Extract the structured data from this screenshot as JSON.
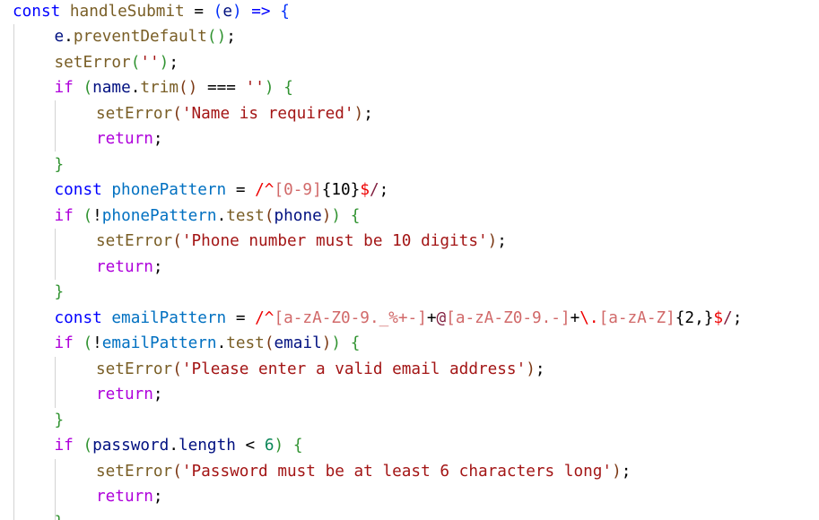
{
  "editor": {
    "colors": {
      "background": "#ffffff",
      "keyword": "#0000ff",
      "control": "#af00db",
      "variable": "#001080",
      "function": "#795e26",
      "string": "#a31515",
      "number": "#098658",
      "regex": "#811f3f",
      "regex_class": "#d16969",
      "regex_anchor": "#ee0000",
      "bracket_1": "#0431fa",
      "bracket_2": "#319331",
      "bracket_3": "#7b3814",
      "indent_guide": "#d3d3d3"
    },
    "lines": [
      [
        [
          "const",
          "kw"
        ],
        [
          " ",
          "op"
        ],
        [
          "handleSubmit",
          "fn"
        ],
        [
          " = ",
          "op"
        ],
        [
          "(",
          "b1"
        ],
        [
          "e",
          "var"
        ],
        [
          ")",
          "b1"
        ],
        [
          " ",
          "op"
        ],
        [
          "=>",
          "kw"
        ],
        [
          " ",
          "op"
        ],
        [
          "{",
          "b1"
        ]
      ],
      [
        [
          "e",
          "var"
        ],
        [
          ".",
          "op"
        ],
        [
          "preventDefault",
          "fn"
        ],
        [
          "(",
          "b2"
        ],
        [
          ")",
          "b2"
        ],
        [
          ";",
          "op"
        ]
      ],
      [
        [
          "setError",
          "fn"
        ],
        [
          "(",
          "b2"
        ],
        [
          "''",
          "str"
        ],
        [
          ")",
          "b2"
        ],
        [
          ";",
          "op"
        ]
      ],
      [
        [
          "if",
          "ctrl"
        ],
        [
          " ",
          "op"
        ],
        [
          "(",
          "b2"
        ],
        [
          "name",
          "var"
        ],
        [
          ".",
          "op"
        ],
        [
          "trim",
          "fn"
        ],
        [
          "(",
          "b3"
        ],
        [
          ")",
          "b3"
        ],
        [
          " === ",
          "op"
        ],
        [
          "''",
          "str"
        ],
        [
          ")",
          "b2"
        ],
        [
          " ",
          "op"
        ],
        [
          "{",
          "b2"
        ]
      ],
      [
        [
          "setError",
          "fn"
        ],
        [
          "(",
          "b3"
        ],
        [
          "'Name is required'",
          "str"
        ],
        [
          ")",
          "b3"
        ],
        [
          ";",
          "op"
        ]
      ],
      [
        [
          "return",
          "ctrl"
        ],
        [
          ";",
          "op"
        ]
      ],
      [
        [
          "}",
          "b2"
        ]
      ],
      [
        [
          "const",
          "kw"
        ],
        [
          " ",
          "op"
        ],
        [
          "phonePattern",
          "const"
        ],
        [
          " = ",
          "op"
        ],
        [
          "/^",
          "regex-anchor"
        ],
        [
          "[0-9]",
          "regex-class"
        ],
        [
          "{10}",
          "regex-quant"
        ],
        [
          "$",
          "regex-anchor"
        ],
        [
          "/",
          "regex"
        ],
        [
          ";",
          "op"
        ]
      ],
      [
        [
          "if",
          "ctrl"
        ],
        [
          " ",
          "op"
        ],
        [
          "(",
          "b2"
        ],
        [
          "!",
          "op"
        ],
        [
          "phonePattern",
          "const"
        ],
        [
          ".",
          "op"
        ],
        [
          "test",
          "fn"
        ],
        [
          "(",
          "b3"
        ],
        [
          "phone",
          "var"
        ],
        [
          ")",
          "b3"
        ],
        [
          ")",
          "b2"
        ],
        [
          " ",
          "op"
        ],
        [
          "{",
          "b2"
        ]
      ],
      [
        [
          "setError",
          "fn"
        ],
        [
          "(",
          "b3"
        ],
        [
          "'Phone number must be 10 digits'",
          "str"
        ],
        [
          ")",
          "b3"
        ],
        [
          ";",
          "op"
        ]
      ],
      [
        [
          "return",
          "ctrl"
        ],
        [
          ";",
          "op"
        ]
      ],
      [
        [
          "}",
          "b2"
        ]
      ],
      [
        [
          "const",
          "kw"
        ],
        [
          " ",
          "op"
        ],
        [
          "emailPattern",
          "const"
        ],
        [
          " = ",
          "op"
        ],
        [
          "/^",
          "regex-anchor"
        ],
        [
          "[a-zA-Z0-9._%+-]",
          "regex-class"
        ],
        [
          "+",
          "regex-quant"
        ],
        [
          "@",
          "regex"
        ],
        [
          "[a-zA-Z0-9.-]",
          "regex-class"
        ],
        [
          "+",
          "regex-quant"
        ],
        [
          "\\.",
          "regex-anchor"
        ],
        [
          "[a-zA-Z]",
          "regex-class"
        ],
        [
          "{2,}",
          "regex-quant"
        ],
        [
          "$",
          "regex-anchor"
        ],
        [
          "/",
          "regex"
        ],
        [
          ";",
          "op"
        ]
      ],
      [
        [
          "if",
          "ctrl"
        ],
        [
          " ",
          "op"
        ],
        [
          "(",
          "b2"
        ],
        [
          "!",
          "op"
        ],
        [
          "emailPattern",
          "const"
        ],
        [
          ".",
          "op"
        ],
        [
          "test",
          "fn"
        ],
        [
          "(",
          "b3"
        ],
        [
          "email",
          "var"
        ],
        [
          ")",
          "b3"
        ],
        [
          ")",
          "b2"
        ],
        [
          " ",
          "op"
        ],
        [
          "{",
          "b2"
        ]
      ],
      [
        [
          "setError",
          "fn"
        ],
        [
          "(",
          "b3"
        ],
        [
          "'Please enter a valid email address'",
          "str"
        ],
        [
          ")",
          "b3"
        ],
        [
          ";",
          "op"
        ]
      ],
      [
        [
          "return",
          "ctrl"
        ],
        [
          ";",
          "op"
        ]
      ],
      [
        [
          "}",
          "b2"
        ]
      ],
      [
        [
          "if",
          "ctrl"
        ],
        [
          " ",
          "op"
        ],
        [
          "(",
          "b2"
        ],
        [
          "password",
          "var"
        ],
        [
          ".",
          "op"
        ],
        [
          "length",
          "var"
        ],
        [
          " < ",
          "op"
        ],
        [
          "6",
          "num"
        ],
        [
          ")",
          "b2"
        ],
        [
          " ",
          "op"
        ],
        [
          "{",
          "b2"
        ]
      ],
      [
        [
          "setError",
          "fn"
        ],
        [
          "(",
          "b3"
        ],
        [
          "'Password must be at least 6 characters long'",
          "str"
        ],
        [
          ")",
          "b3"
        ],
        [
          ";",
          "op"
        ]
      ],
      [
        [
          "return",
          "ctrl"
        ],
        [
          ";",
          "op"
        ]
      ],
      [
        [
          "}",
          "b2"
        ]
      ]
    ]
  }
}
